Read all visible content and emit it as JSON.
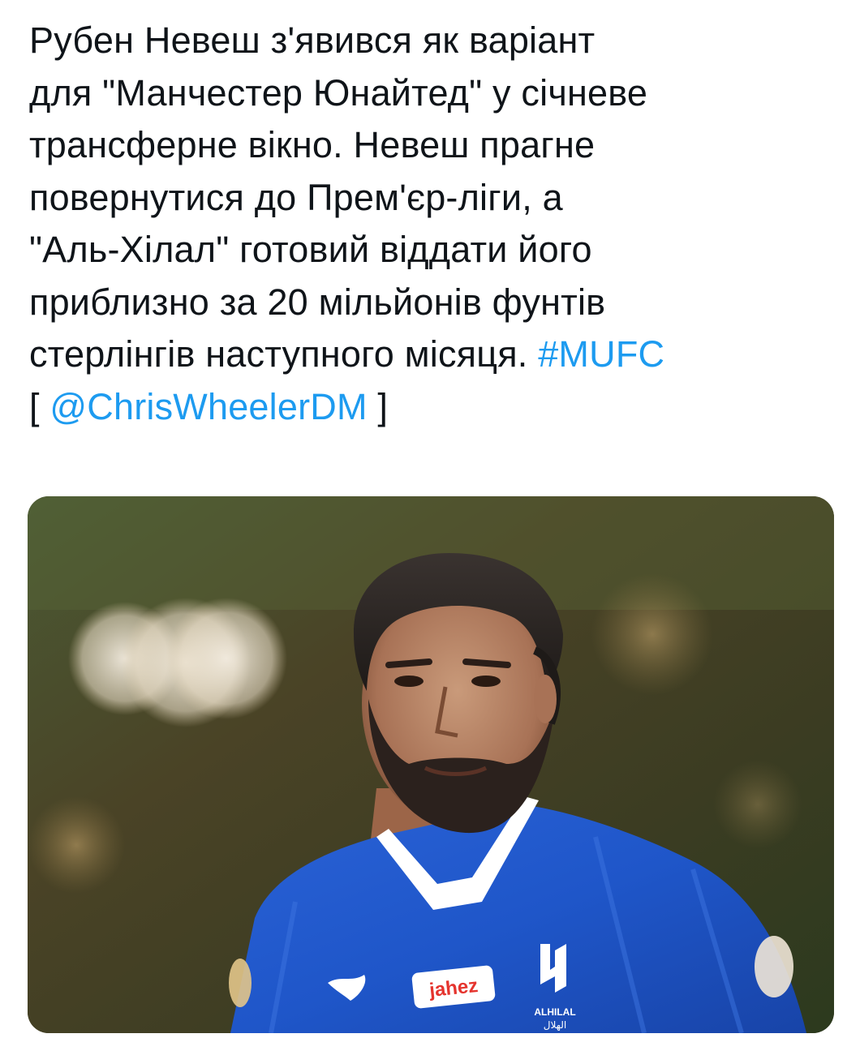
{
  "tweet": {
    "lines": [
      "Рубен Невеш з'явився як варіант",
      "для \"Манчестер Юнайтед\" у січневе",
      "трансферне вікно. Невеш прагне",
      "повернутися до Прем'єр-ліги, а",
      "\"Аль-Хілал\" готовий віддати його",
      "приблизно за 20 мільйонів фунтів",
      "стерлінгів наступного місяця."
    ],
    "hashtag": "#MUFC",
    "bracket_open": "[",
    "mention": "@ChrisWheelerDM",
    "bracket_close": "]"
  },
  "media": {
    "jersey_sponsor": "jahez",
    "club_crest_text": "ALHILAL",
    "club_crest_arabic": "الهلال",
    "colors": {
      "jersey_blue": "#1f56c9",
      "collar_white": "#ffffff",
      "link_blue": "#1d9bf0",
      "text": "#0f1419"
    }
  }
}
